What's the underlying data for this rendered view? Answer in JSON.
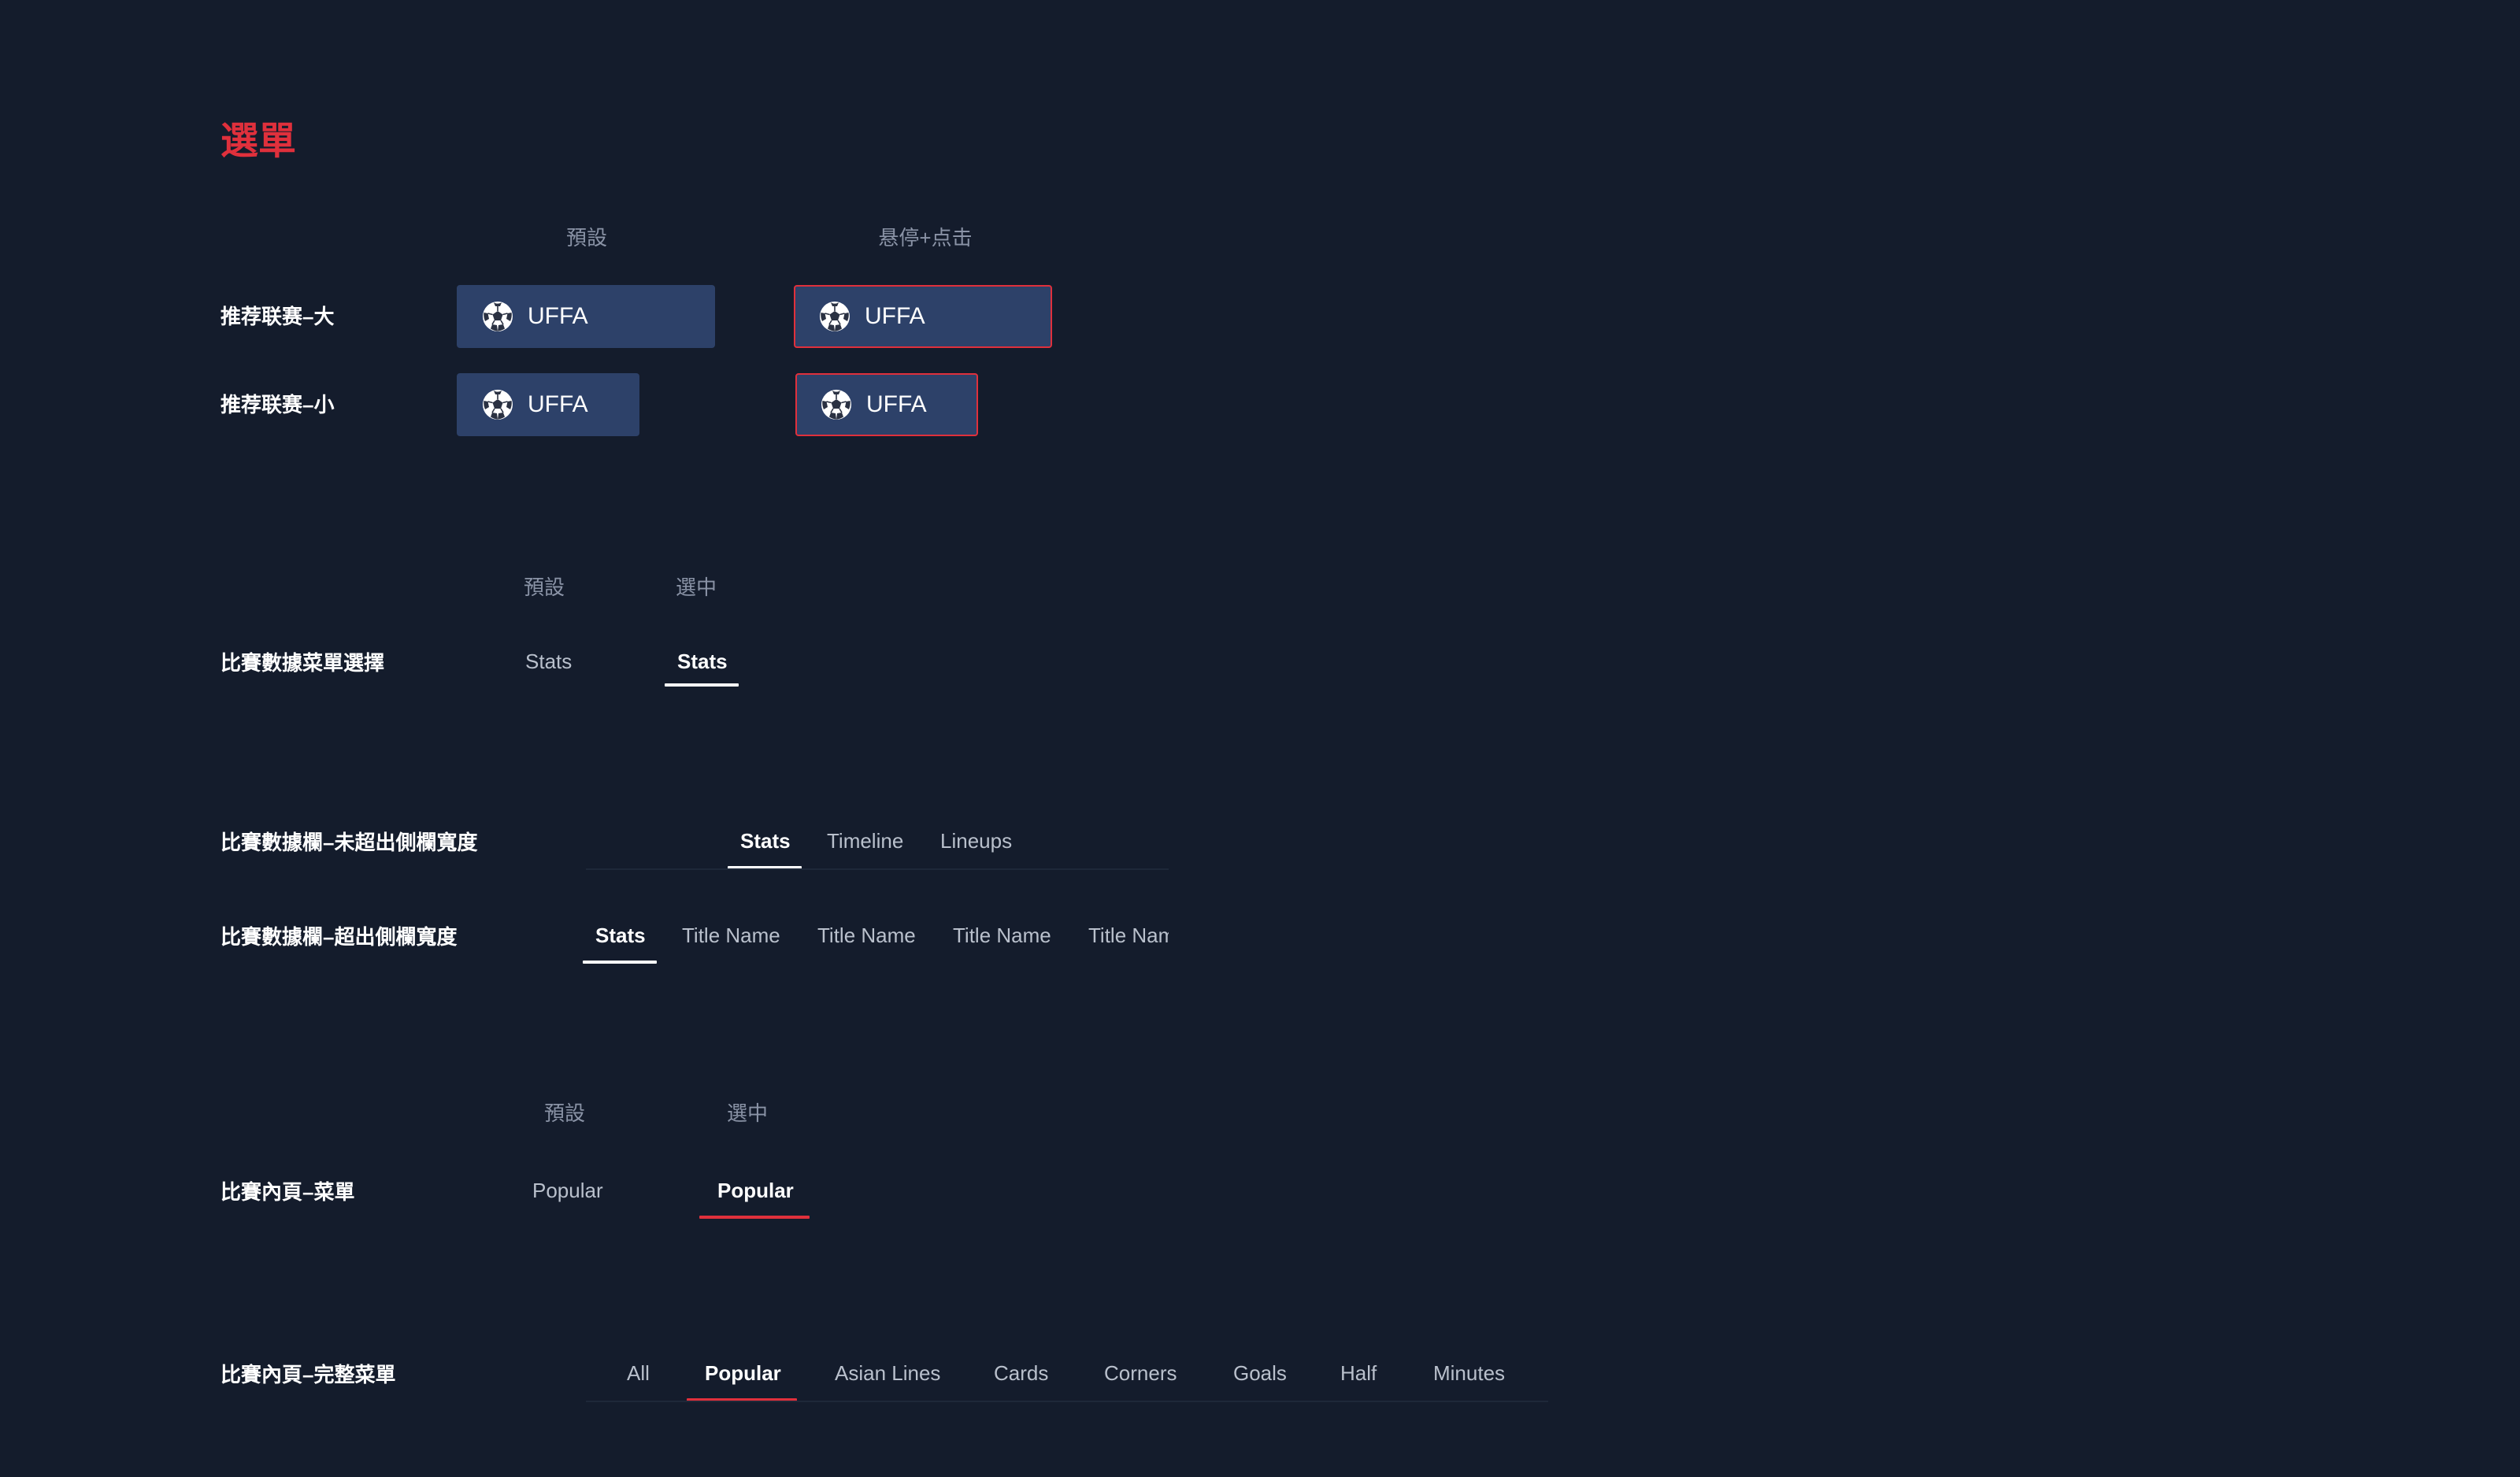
{
  "title": "選單",
  "section1": {
    "col_default": "預設",
    "col_hover": "悬停+点击",
    "rows": [
      {
        "label": "推荐联赛–大",
        "chip_label": "UFFA"
      },
      {
        "label": "推荐联赛–小",
        "chip_label": "UFFA"
      }
    ]
  },
  "section2": {
    "col_default": "預設",
    "col_selected": "選中",
    "row_label": "比賽數據菜單選擇",
    "tab_default": "Stats",
    "tab_selected": "Stats"
  },
  "section3": {
    "row1_label": "比賽數據欄–未超出側欄寬度",
    "row1_tabs": [
      "Stats",
      "Timeline",
      "Lineups"
    ],
    "row2_label": "比賽數據欄–超出側欄寬度",
    "row2_tabs": [
      "Stats",
      "Title Name",
      "Title Name",
      "Title Name",
      "Title Name"
    ]
  },
  "section4": {
    "col_default": "預設",
    "col_selected": "選中",
    "row_label": "比賽內頁–菜單",
    "tab_default": "Popular",
    "tab_selected": "Popular"
  },
  "section5": {
    "row_label": "比賽內頁–完整菜單",
    "tabs": [
      "All",
      "Popular",
      "Asian Lines",
      "Cards",
      "Corners",
      "Goals",
      "Half",
      "Minutes"
    ]
  },
  "colors": {
    "background": "#141c2c",
    "accent_red": "#e0303c",
    "chip_fill": "#2d4169",
    "muted_text": "#8a93a6",
    "tab_text": "#b9c0cc"
  },
  "icons": {
    "chip_icon": "soccer-ball-icon"
  }
}
